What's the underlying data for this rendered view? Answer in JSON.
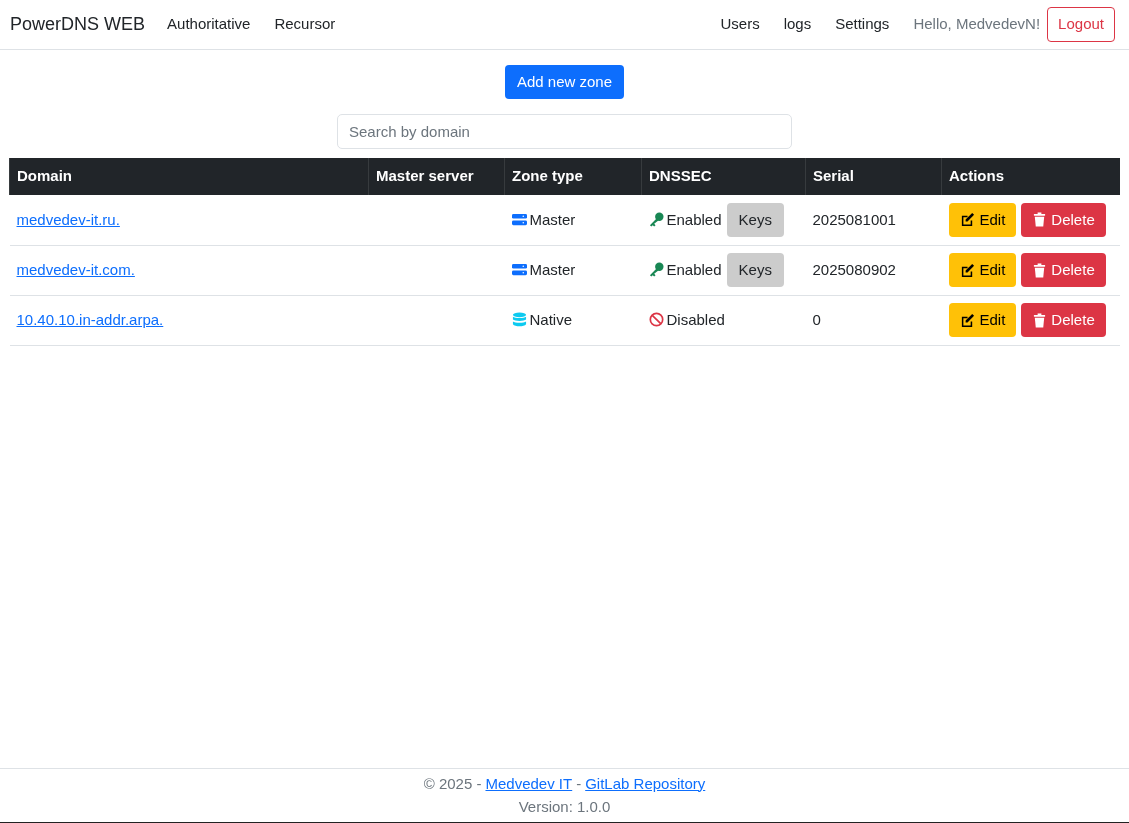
{
  "navbar": {
    "brand": "PowerDNS WEB",
    "left_links": [
      "Authoritative",
      "Recursor"
    ],
    "right_links": [
      "Users",
      "logs",
      "Settings"
    ],
    "greeting": "Hello, MedvedevN!",
    "logout": "Logout"
  },
  "add_button": "Add new zone",
  "search": {
    "placeholder": "Search by domain"
  },
  "table": {
    "columns": [
      "Domain",
      "Master server",
      "Zone type",
      "DNSSEC",
      "Serial",
      "Actions"
    ],
    "rows": [
      {
        "domain": "medvedev-it.ru.",
        "master_server": "",
        "zone_type": {
          "kind": "master",
          "label": "Master"
        },
        "dnssec": {
          "enabled": true,
          "label": "Enabled",
          "keys_button": "Keys"
        },
        "serial": "2025081001",
        "actions": [
          "Edit",
          "Delete"
        ]
      },
      {
        "domain": "medvedev-it.com.",
        "master_server": "",
        "zone_type": {
          "kind": "master",
          "label": "Master"
        },
        "dnssec": {
          "enabled": true,
          "label": "Enabled",
          "keys_button": "Keys"
        },
        "serial": "2025080902",
        "actions": [
          "Edit",
          "Delete"
        ]
      },
      {
        "domain": "10.40.10.in-addr.arpa.",
        "master_server": "",
        "zone_type": {
          "kind": "native",
          "label": "Native"
        },
        "dnssec": {
          "enabled": false,
          "label": "Disabled"
        },
        "serial": "0",
        "actions": [
          "Edit",
          "Delete"
        ]
      }
    ]
  },
  "footer": {
    "copyright": "© 2025 -",
    "company_link": "Medvedev IT",
    "separator": "-",
    "repo_link": "GitLab Repository",
    "version": "Version: 1.0.0"
  }
}
